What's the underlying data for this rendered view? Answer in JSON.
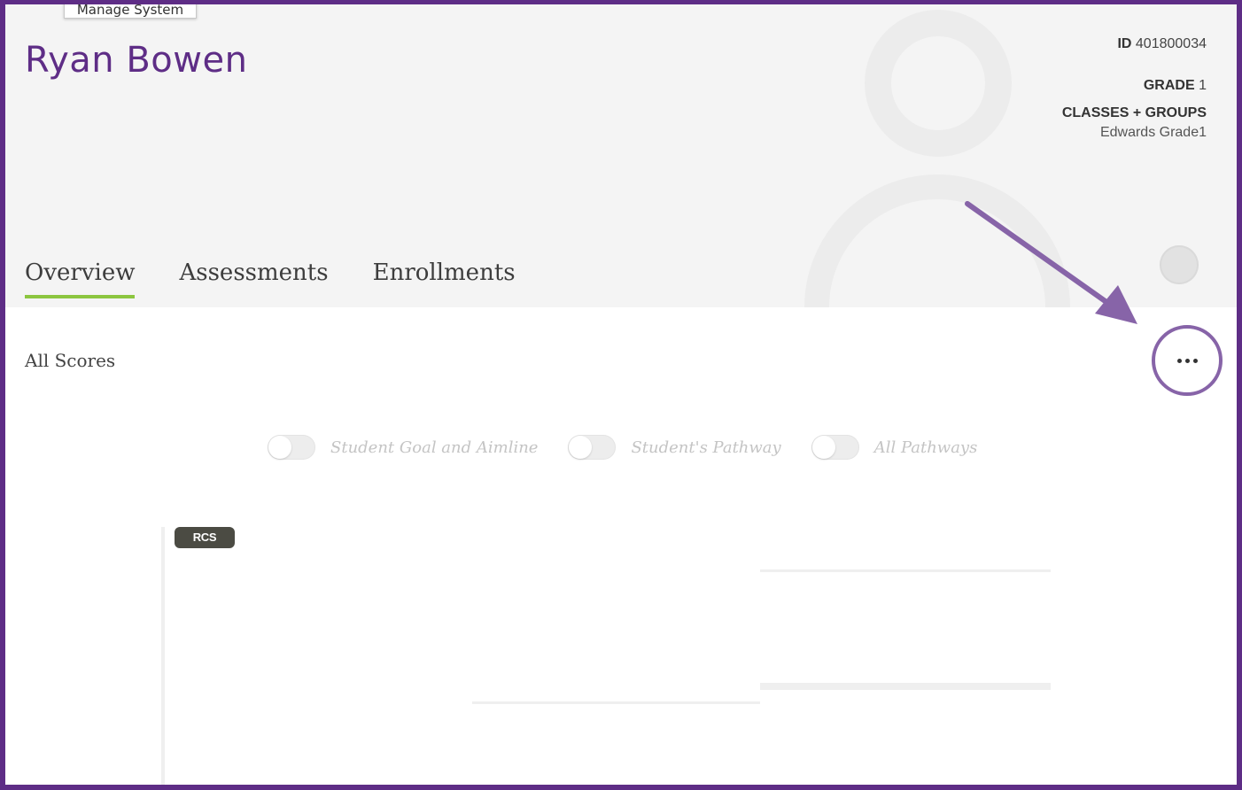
{
  "tooltip": {
    "text": "Manage System"
  },
  "student": {
    "name": "Ryan Bowen",
    "id_label": "ID",
    "id_value": "401800034",
    "grade_label": "GRADE",
    "grade_value": "1",
    "classes_label": "CLASSES + GROUPS",
    "classes_value": "Edwards Grade1"
  },
  "tabs": [
    {
      "label": "Overview",
      "active": true
    },
    {
      "label": "Assessments",
      "active": false
    },
    {
      "label": "Enrollments",
      "active": false
    }
  ],
  "section": {
    "title": "All Scores"
  },
  "more_button": {
    "icon": "more-horizontal-icon"
  },
  "annotation": {
    "arrow_color": "#8764a8"
  },
  "toggles": [
    {
      "label": "Student Goal and Aimline",
      "on": false
    },
    {
      "label": "Student's Pathway",
      "on": false
    },
    {
      "label": "All Pathways",
      "on": false
    }
  ],
  "chart": {
    "badge": "RCS"
  },
  "colors": {
    "brand_purple": "#5e2d86",
    "active_tab_underline": "#8cc63f",
    "header_bg": "#f4f4f4"
  }
}
